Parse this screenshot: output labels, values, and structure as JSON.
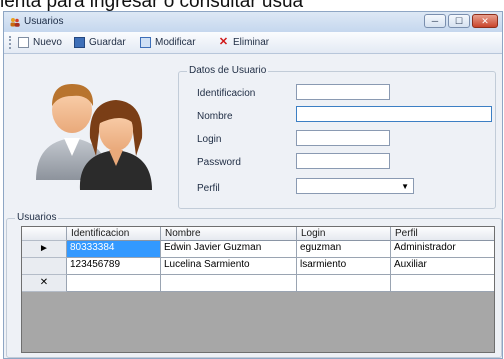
{
  "caption_text": "ienta para ingresar o consultar usua",
  "window": {
    "title": "Usuarios",
    "controls": {
      "minimize": "─",
      "maximize": "☐",
      "close": "✕"
    }
  },
  "toolbar": {
    "nuevo_label": "Nuevo",
    "guardar_label": "Guardar",
    "modificar_label": "Modificar",
    "eliminar_label": "Eliminar"
  },
  "datos": {
    "legend": "Datos de Usuario",
    "fields": {
      "identificacion": {
        "label": "Identificacion",
        "value": ""
      },
      "nombre": {
        "label": "Nombre",
        "value": ""
      },
      "login": {
        "label": "Login",
        "value": ""
      },
      "password": {
        "label": "Password",
        "value": ""
      },
      "perfil": {
        "label": "Perfil",
        "value": ""
      }
    }
  },
  "usuarios": {
    "legend": "Usuarios",
    "columns": [
      "Identificacion",
      "Nombre",
      "Login",
      "Perfil"
    ],
    "rows": [
      {
        "identificacion": "80333384",
        "nombre": "Edwin Javier Guzman",
        "login": "eguzman",
        "perfil": "Administrador",
        "indicator": "►"
      },
      {
        "identificacion": "123456789",
        "nombre": "Lucelina Sarmiento",
        "login": "lsarmiento",
        "perfil": "Auxiliar",
        "indicator": ""
      }
    ],
    "new_row_indicator": "✕"
  }
}
